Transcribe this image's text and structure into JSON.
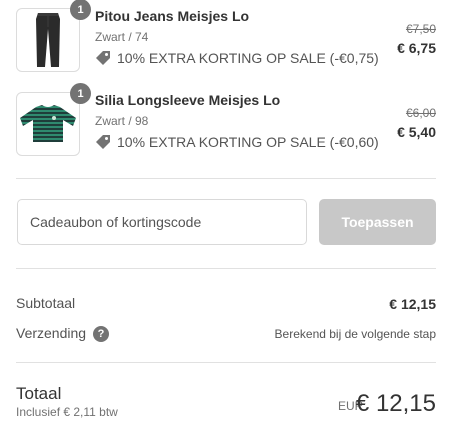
{
  "items": [
    {
      "quantity": "1",
      "title": "Pitou Jeans Meisjes Lo",
      "variant": "Zwart / 74",
      "discount": "10% EXTRA KORTING OP SALE (-€0,75)",
      "old_price": "€7,50",
      "new_price": "€ 6,75",
      "image": "black-jeans"
    },
    {
      "quantity": "1",
      "title": "Silia Longsleeve Meisjes Lo",
      "variant": "Zwart / 98",
      "discount": "10% EXTRA KORTING OP SALE (-€0,60)",
      "old_price": "€6,00",
      "new_price": "€ 5,40",
      "image": "striped-longsleeve"
    }
  ],
  "discount_code": {
    "placeholder": "Cadeaubon of kortingscode",
    "value": "",
    "apply_label": "Toepassen"
  },
  "summary": {
    "subtotal_label": "Subtotaal",
    "subtotal_value": "€ 12,15",
    "shipping_label": "Verzending",
    "shipping_value": "Berekend bij de volgende stap",
    "help_icon": "?"
  },
  "total": {
    "label": "Totaal",
    "tax_note": "Inclusief € 2,11 btw",
    "currency": "EUR",
    "value": "€ 12,15"
  },
  "colors": {
    "badge": "#737373",
    "apply_button_disabled": "#c8c8c8",
    "divider": "#e1e1e1"
  }
}
